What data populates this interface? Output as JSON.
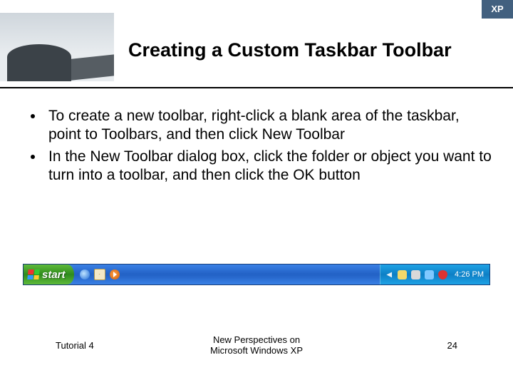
{
  "header": {
    "corner_label": "XP",
    "title": "Creating a Custom Taskbar Toolbar"
  },
  "bullets": [
    "To create a new toolbar, right-click a blank area of the taskbar, point to Toolbars, and then click New Toolbar",
    "In the New Toolbar dialog box, click the folder or object you want to turn into a toolbar, and then click the OK button"
  ],
  "taskbar": {
    "start_label": "start",
    "clock": "4:26 PM"
  },
  "footer": {
    "left": "Tutorial 4",
    "center_line1": "New Perspectives on",
    "center_line2": "Microsoft Windows XP",
    "page_number": "24"
  }
}
